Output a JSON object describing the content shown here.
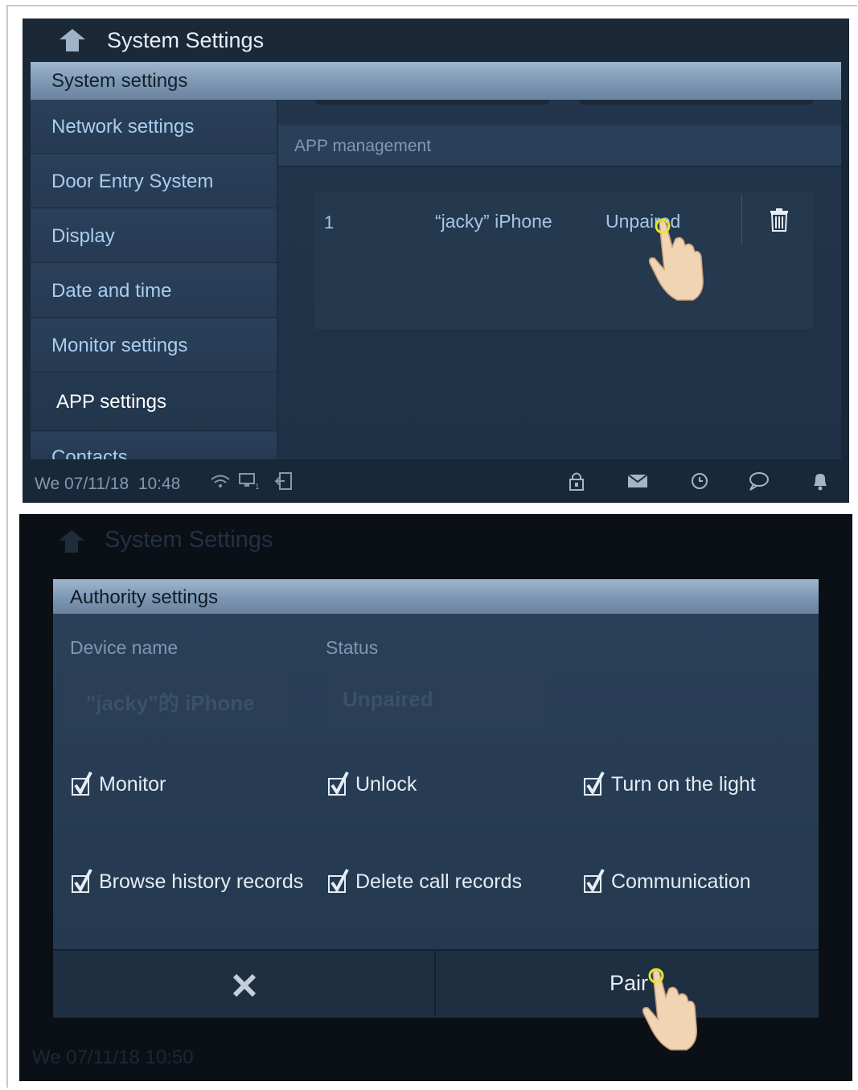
{
  "screen1": {
    "title": "System Settings",
    "section_header": "System settings",
    "menu": [
      {
        "label": "Network settings"
      },
      {
        "label": "Door Entry System"
      },
      {
        "label": "Display"
      },
      {
        "label": "Date and time"
      },
      {
        "label": "Monitor settings"
      },
      {
        "label": "APP settings",
        "active": true
      },
      {
        "label": "Contacts"
      }
    ],
    "content_header": "APP management",
    "device_row": {
      "index": "1",
      "name": "“jacky” iPhone",
      "status": "Unpaired"
    },
    "status_bar": {
      "date": "We 07/11/18",
      "time": "10:48",
      "icons": [
        "wifi-icon",
        "monitor-icon",
        "exit-icon",
        "lock-icon",
        "mail-icon",
        "history-icon",
        "chat-icon",
        "bell-icon"
      ]
    }
  },
  "screen2": {
    "background_title": "System Settings",
    "background_status": "We 07/11/18  10:50",
    "dialog": {
      "title": "Authority settings",
      "device_name_label": "Device name",
      "status_label": "Status",
      "device_name_value": "\"jacky\"的 iPhone",
      "status_value": "Unpaired",
      "permissions": [
        {
          "label": "Monitor",
          "checked": true
        },
        {
          "label": "Unlock",
          "checked": true
        },
        {
          "label": "Turn on the light",
          "checked": true
        },
        {
          "label": "Browse history records",
          "checked": true
        },
        {
          "label": "Delete call records",
          "checked": true
        },
        {
          "label": "Communication",
          "checked": true
        }
      ],
      "cancel_icon": "close-icon",
      "confirm_label": "Pair"
    }
  },
  "colors": {
    "header_blue": "#8aa3be",
    "menu_text": "#aacdf0",
    "panel_bg": "#253a51",
    "touch_ring": "#e2e82a"
  }
}
